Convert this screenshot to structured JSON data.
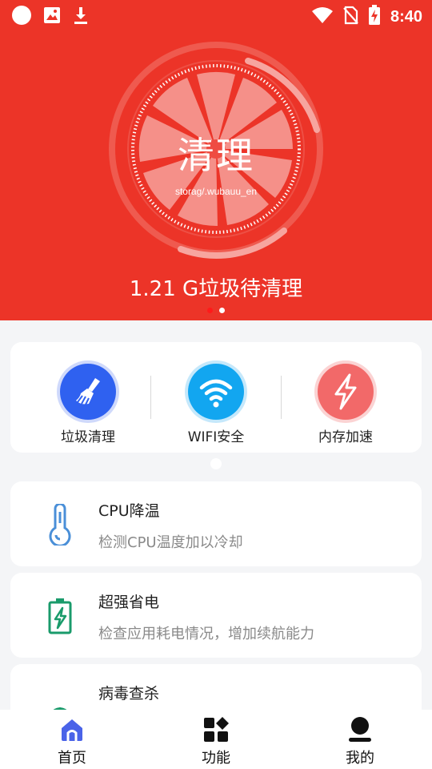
{
  "status_bar": {
    "time": "8:40",
    "left_icons": [
      "circle-icon",
      "image-icon",
      "download-icon"
    ],
    "right_icons": [
      "wifi-icon",
      "no-sim-icon",
      "battery-charging-icon"
    ]
  },
  "hero": {
    "title": "清理",
    "path": "storag/.wubauu_en",
    "junk_amount": "1.21 G垃圾待清理",
    "pager": {
      "count": 2,
      "active_index": 0
    },
    "colors": {
      "background": "#ec3428",
      "ring": "#f27a70",
      "slice": "#f59089"
    }
  },
  "quick_actions": [
    {
      "label": "垃圾清理",
      "icon": "broom-icon",
      "color": "#2f61f0"
    },
    {
      "label": "WIFI安全",
      "icon": "wifi-icon",
      "color": "#12a6f0"
    },
    {
      "label": "内存加速",
      "icon": "lightning-icon",
      "color": "#f26969"
    }
  ],
  "features": [
    {
      "title": "CPU降温",
      "desc": "检测CPU温度加以冷却",
      "icon": "thermometer-icon",
      "color": "#4a8fd8"
    },
    {
      "title": "超强省电",
      "desc": "检查应用耗电情况，增加续航能力",
      "icon": "battery-icon",
      "color": "#1a9b6b"
    },
    {
      "title": "病毒查杀",
      "desc": "",
      "icon": "shield-scan-icon",
      "color": "#1a9b6b"
    }
  ],
  "bottom_nav": [
    {
      "label": "首页",
      "icon": "home-icon",
      "active": true,
      "color": "#4a63e8"
    },
    {
      "label": "功能",
      "icon": "grid-icon",
      "active": false,
      "color": "#111111"
    },
    {
      "label": "我的",
      "icon": "user-icon",
      "active": false,
      "color": "#111111"
    }
  ]
}
